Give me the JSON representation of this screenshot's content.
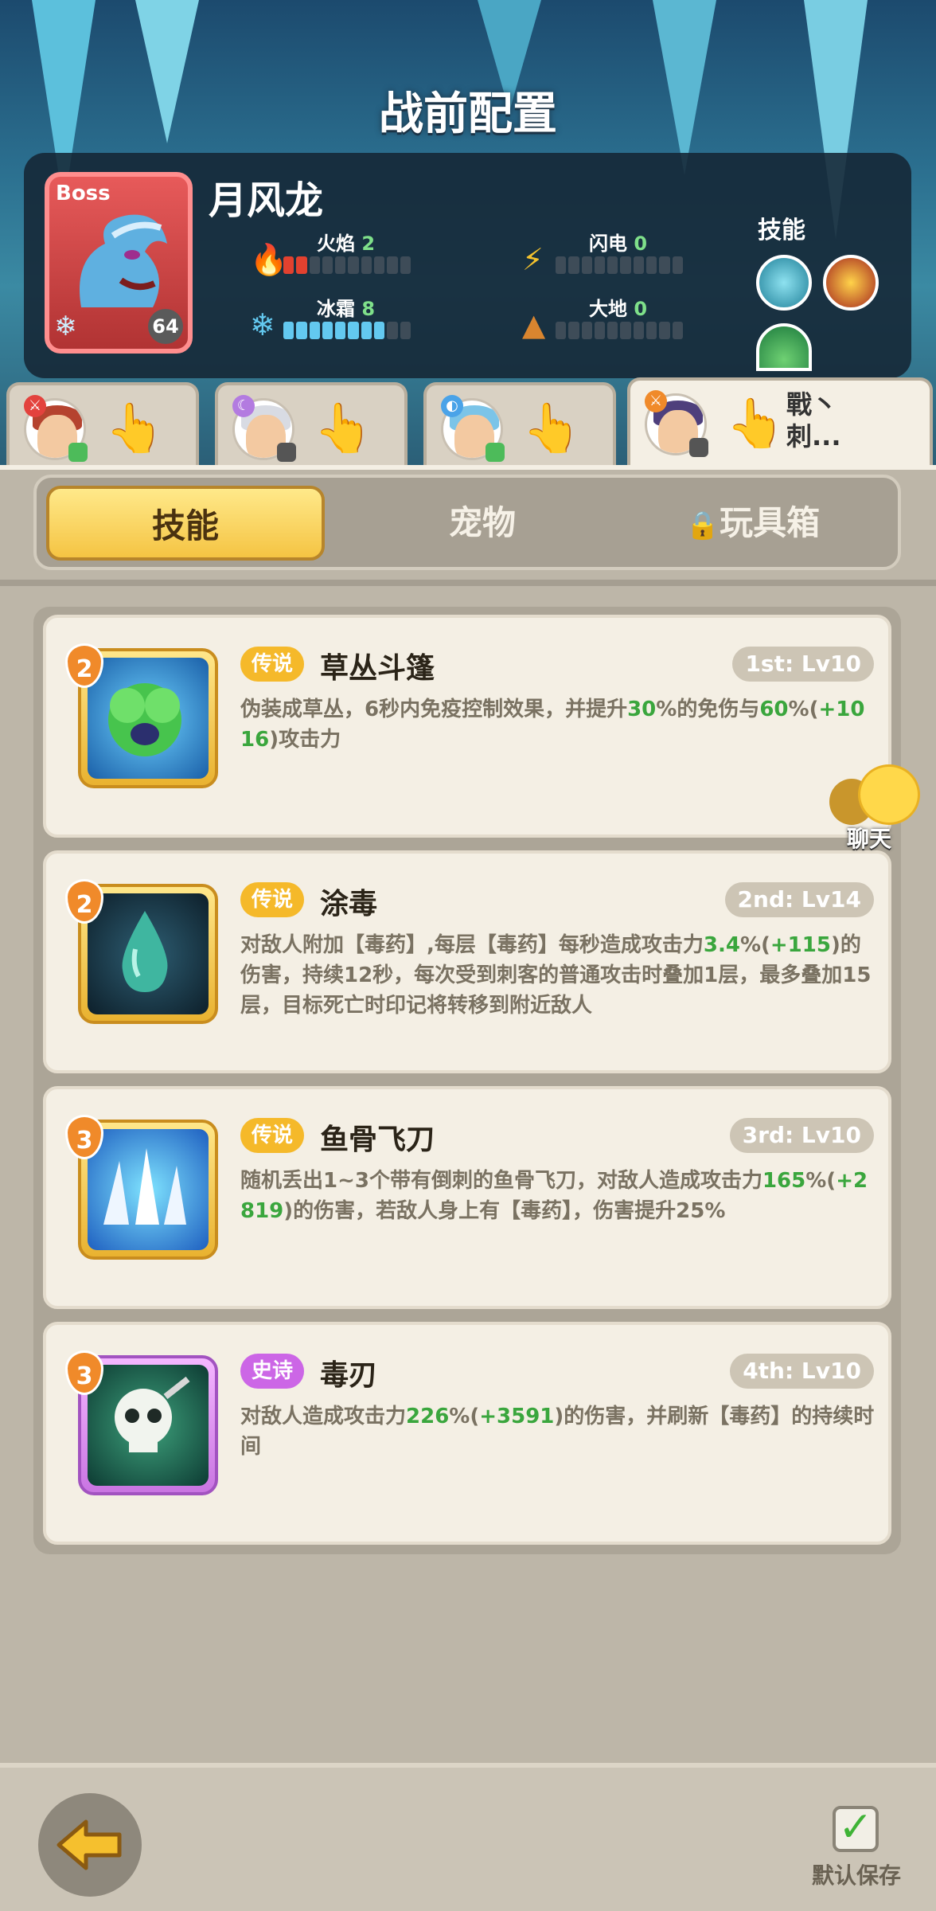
{
  "header": {
    "title": "战前配置"
  },
  "boss": {
    "tag": "Boss",
    "name": "月风龙",
    "level": "64",
    "skills_label": "技能",
    "stats": [
      {
        "label": "火焰",
        "value": "2",
        "fill": 2,
        "color": "#e2412f"
      },
      {
        "label": "闪电",
        "value": "0",
        "fill": 0,
        "color": "#f5c32d"
      },
      {
        "label": "冰霜",
        "value": "8",
        "fill": 8,
        "color": "#63c9f0"
      },
      {
        "label": "大地",
        "value": "0",
        "fill": 0,
        "color": "#d9852f"
      }
    ]
  },
  "heroes": [
    {
      "badge_color": "#e3423d",
      "hair_color": "#b5432f"
    },
    {
      "badge_color": "#b37be0",
      "hair_color": "#d8dbe3"
    },
    {
      "badge_color": "#4aa3e8",
      "hair_color": "#7bc4e8"
    },
    {
      "badge_color": "#f08a2a",
      "hair_color": "#4e3f7c",
      "name": "戰丶刺..."
    }
  ],
  "tabs": {
    "skills": "技能",
    "pets": "宠物",
    "toybox": "玩具箱"
  },
  "skill_cards": [
    {
      "rank": "2",
      "rarity": "传说",
      "name": "草丛斗篷",
      "slot": "1st: Lv10",
      "desc": [
        "伪装成草丛，6秒内免疫控制效果，并提升",
        "30",
        "%的免伤与",
        "60",
        "%(",
        "+1016",
        ")攻击力"
      ]
    },
    {
      "rank": "2",
      "rarity": "传说",
      "name": "涂毒",
      "slot": "2nd: Lv14",
      "desc": [
        "对敌人附加【毒药】,每层【毒药】每秒造成攻击力",
        "3.4",
        "%(",
        "+115",
        ")的伤害，持续12秒，每次受到刺客的普通攻击时叠加1层，最多叠加15层，目标死亡时印记将转移到附近敌人"
      ]
    },
    {
      "rank": "3",
      "rarity": "传说",
      "name": "鱼骨飞刀",
      "slot": "3rd: Lv10",
      "desc": [
        "随机丢出1~3个带有倒刺的鱼骨飞刀，对敌人造成攻击力",
        "165",
        "%(",
        "+2819",
        ")的伤害，若敌人身上有【毒药】，伤害提升25%"
      ]
    },
    {
      "rank": "3",
      "rarity": "史诗",
      "name": "毒刃",
      "slot": "4th: Lv10",
      "desc": [
        "对敌人造成攻击力",
        "226",
        "%(",
        "+3591",
        ")的伤害，并刷新【毒药】的持续时间"
      ]
    }
  ],
  "chat": {
    "label": "聊天"
  },
  "footer": {
    "save_label": "默认保存"
  }
}
